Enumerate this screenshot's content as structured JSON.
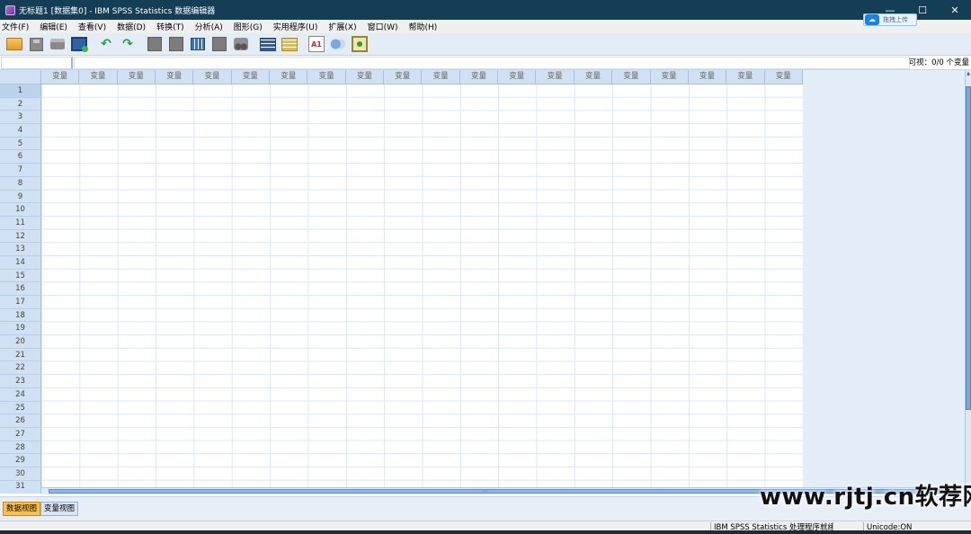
{
  "window": {
    "title": "无标题1 [数据集0] - IBM SPSS Statistics 数据编辑器",
    "minimize": "—",
    "maximize": "☐",
    "close": "✕"
  },
  "upload_badge": {
    "label": "拖拽上传"
  },
  "menu": [
    "文件(F)",
    "编辑(E)",
    "查看(V)",
    "数据(D)",
    "转换(T)",
    "分析(A)",
    "图形(G)",
    "实用程序(U)",
    "扩展(X)",
    "窗口(W)",
    "帮助(H)"
  ],
  "toolbar_icons": [
    "open-folder-icon",
    "save-icon",
    "print-icon",
    "recall-dialog-icon",
    "undo-icon",
    "redo-icon",
    "goto-case-icon",
    "goto-variable-icon",
    "variables-icon",
    "run-descriptives-icon",
    "find-icon",
    "split-file-icon",
    "select-cases-icon",
    "value-labels-icon",
    "use-sets-icon",
    "show-all-variables-icon"
  ],
  "editor": {
    "visible_count": "可视：0/0 个变量"
  },
  "grid": {
    "column_header": "变量",
    "column_count": 20,
    "row_count": 30,
    "next_row_label": "31"
  },
  "tabs": {
    "data_view": "数据视图",
    "variable_view": "变量视图"
  },
  "status": {
    "processor": "IBM SPSS Statistics 处理程序就绪",
    "unicode": "Unicode:ON"
  },
  "watermark": "www.rjtj.cn软荐网",
  "colors": {
    "titlebar": "#143d56",
    "active_tab": "#f8c249",
    "header_bg": "#cfe1f3"
  }
}
